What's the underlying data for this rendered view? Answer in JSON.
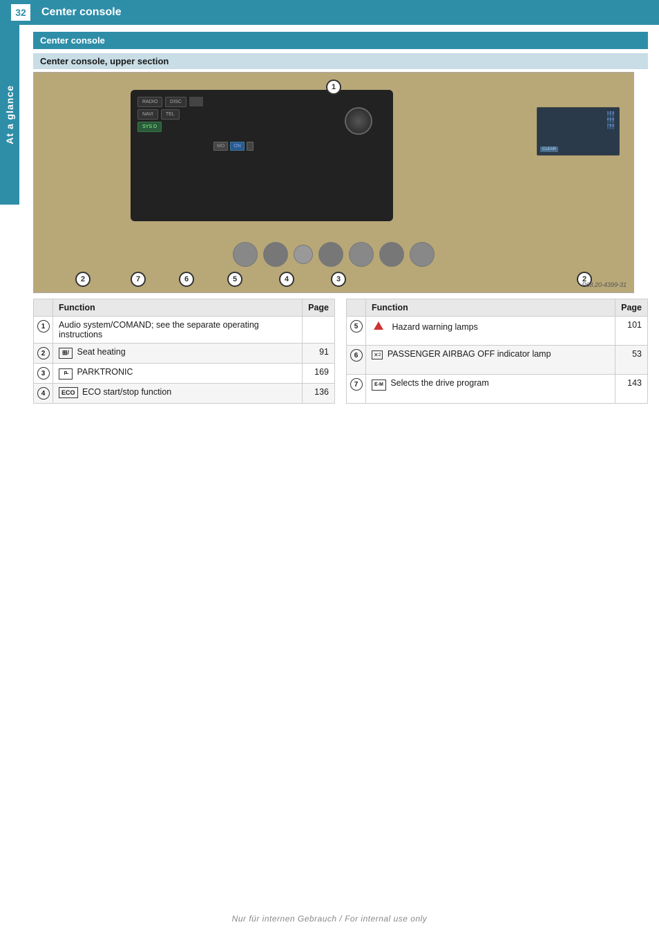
{
  "header": {
    "page_number": "32",
    "title": "Center console"
  },
  "side_tab": {
    "label": "At a glance"
  },
  "section": {
    "title": "Center console",
    "subsection": "Center console, upper section"
  },
  "image": {
    "ref": "P68.20-4399-31"
  },
  "left_table": {
    "col_function": "Function",
    "col_page": "Page",
    "rows": [
      {
        "num": "①",
        "icon": "",
        "text": "Audio system/COMAND; see the separate operating instructions",
        "page": ""
      },
      {
        "num": "②",
        "icon": "seat",
        "text": "Seat heating",
        "page": "91"
      },
      {
        "num": "③",
        "icon": "parktronic",
        "text": "PARKTRONIC",
        "page": "169"
      },
      {
        "num": "④",
        "icon": "eco",
        "text": "ECO start/stop function",
        "page": "136"
      }
    ]
  },
  "right_table": {
    "col_function": "Function",
    "col_page": "Page",
    "rows": [
      {
        "num": "⑤",
        "icon": "hazard",
        "text": "Hazard warning lamps",
        "page": "101"
      },
      {
        "num": "⑥",
        "icon": "airbag",
        "text": "PASSENGER AIRBAG OFF indicator lamp",
        "page": "53"
      },
      {
        "num": "⑦",
        "icon": "drive",
        "text": "Selects the drive program",
        "page": "143"
      }
    ]
  },
  "watermark": "Nur für internen Gebrauch / For internal use only"
}
